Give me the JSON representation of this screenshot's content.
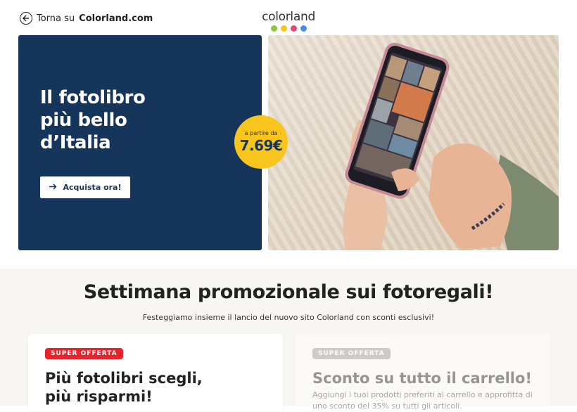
{
  "topbar": {
    "back_prefix": "Torna su",
    "back_site": "Colorland.com",
    "logo": "colorland",
    "logo_dot_colors": [
      "#8cc63f",
      "#f7c51c",
      "#e6457a",
      "#4a90d9"
    ]
  },
  "hero": {
    "title_line1": "Il fotolibro",
    "title_line2": "più bello",
    "title_line3": "d’Italia",
    "cta_label": "Acquista ora!",
    "price_from": "a partire da",
    "price_value": "7.69€"
  },
  "promo": {
    "title": "Settimana promozionale sui fotoregali!",
    "subtitle": "Festeggiamo insieme il lancio del nuovo sito Colorland con sconti esclusivi!",
    "cards": [
      {
        "badge": "SUPER OFFERTA",
        "title": "Più fotolibri scegli, più risparmi!",
        "text": ""
      },
      {
        "badge": "SUPER OFFERTA",
        "title": "Sconto su tutto il carrello!",
        "text": "Aggiungi i tuoi prodotti preferiti al carrello e approfitta di uno sconto del 35% su tutti gli articoli."
      }
    ]
  },
  "colors": {
    "navy": "#16355a",
    "yellow": "#f7c51c",
    "badge_red": "#e5242b",
    "badge_gray": "#9a9a9a"
  }
}
